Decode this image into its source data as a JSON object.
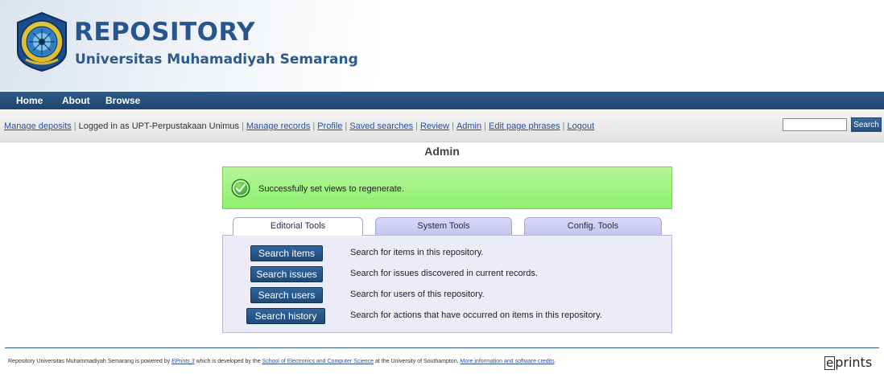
{
  "header": {
    "title": "REPOSITORY",
    "subtitle": "Universitas Muhamadiyah Semarang"
  },
  "menu": {
    "items": [
      "Home",
      "About",
      "Browse"
    ]
  },
  "key_tools": {
    "manage_deposits": "Manage deposits",
    "logged_in": "Logged in as UPT-Perpustakaan Unimus",
    "links": [
      "Manage records",
      "Profile",
      "Saved searches",
      "Review",
      "Admin",
      "Edit page phrases",
      "Logout"
    ]
  },
  "search": {
    "value": "",
    "button_label": "Search"
  },
  "page": {
    "title": "Admin"
  },
  "message": {
    "text": "Successfully set views to regenerate."
  },
  "tabs": [
    {
      "label": "Editorial Tools",
      "active": true
    },
    {
      "label": "System Tools",
      "active": false
    },
    {
      "label": "Config. Tools",
      "active": false
    }
  ],
  "tools": [
    {
      "label": "Search items",
      "description": "Search for items in this repository."
    },
    {
      "label": "Search issues",
      "description": "Search for issues discovered in current records."
    },
    {
      "label": "Search users",
      "description": "Search for users of this repository."
    },
    {
      "label": "Search history",
      "description": "Search for actions that have occurred on items in this repository."
    }
  ],
  "footer": {
    "part1": "Repository Universitas Muhammadiyah Semarang is powered by ",
    "eprints_link": "EPrints 3",
    "part2": " which is developed by the ",
    "school_link": "School of Electronics and Computer Science",
    "part3": " at the University of Southampton. ",
    "more_link": "More information and software credits",
    "part4": ".",
    "logo_e": "e",
    "logo_rest": "prints"
  },
  "colors": {
    "brand_blue": "#27568f",
    "nav_bar": "#1f4670",
    "success_green": "#8ef06e",
    "link": "#2b4f9a"
  }
}
